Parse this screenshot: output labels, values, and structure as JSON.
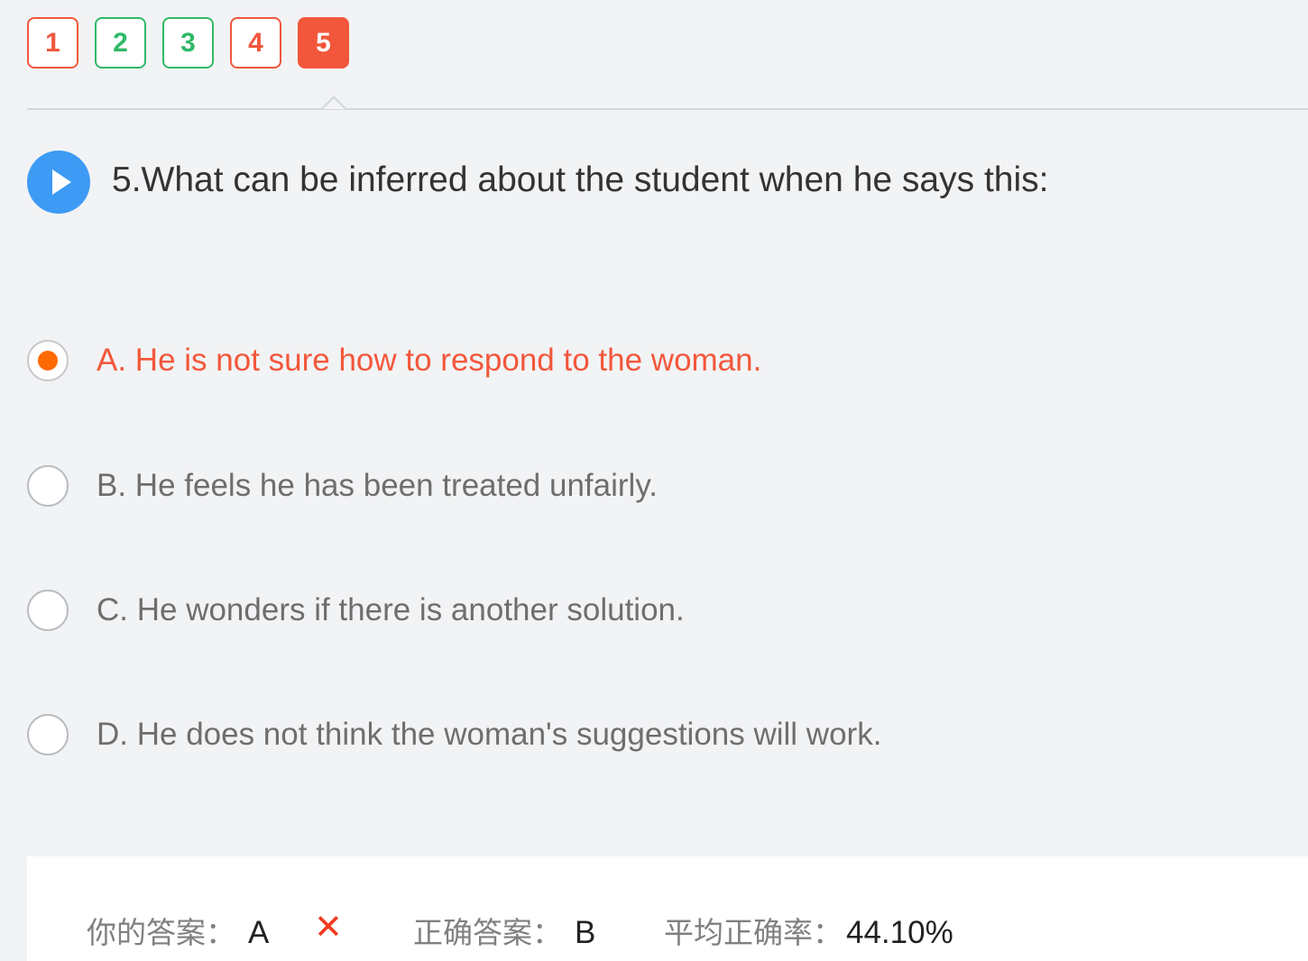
{
  "tabs": [
    {
      "label": "1",
      "status": "wrong"
    },
    {
      "label": "2",
      "status": "correct"
    },
    {
      "label": "3",
      "status": "correct"
    },
    {
      "label": "4",
      "status": "wrong"
    },
    {
      "label": "5",
      "status": "active"
    }
  ],
  "question": {
    "text": "5.What can be inferred about the student when he says this:",
    "play_icon": "play-icon"
  },
  "options": [
    {
      "label": "A. He is not sure how to respond to the woman.",
      "selected": true
    },
    {
      "label": "B. He feels he has been treated unfairly.",
      "selected": false
    },
    {
      "label": "C. He wonders if there is another solution.",
      "selected": false
    },
    {
      "label": "D. He does not think the woman's suggestions will work.",
      "selected": false
    }
  ],
  "result": {
    "your_answer_label": "你的答案：",
    "your_answer_value": "A",
    "wrong_mark": "✕",
    "correct_answer_label": "正确答案：",
    "correct_answer_value": "B",
    "avg_rate_label": "平均正确率：",
    "avg_rate_value": "44.10%"
  },
  "colors": {
    "wrong": "#f0573d",
    "correct": "#2fb969",
    "active": "#f3573b",
    "play": "#3d9bf5",
    "selected_dot": "#ff6a00"
  }
}
